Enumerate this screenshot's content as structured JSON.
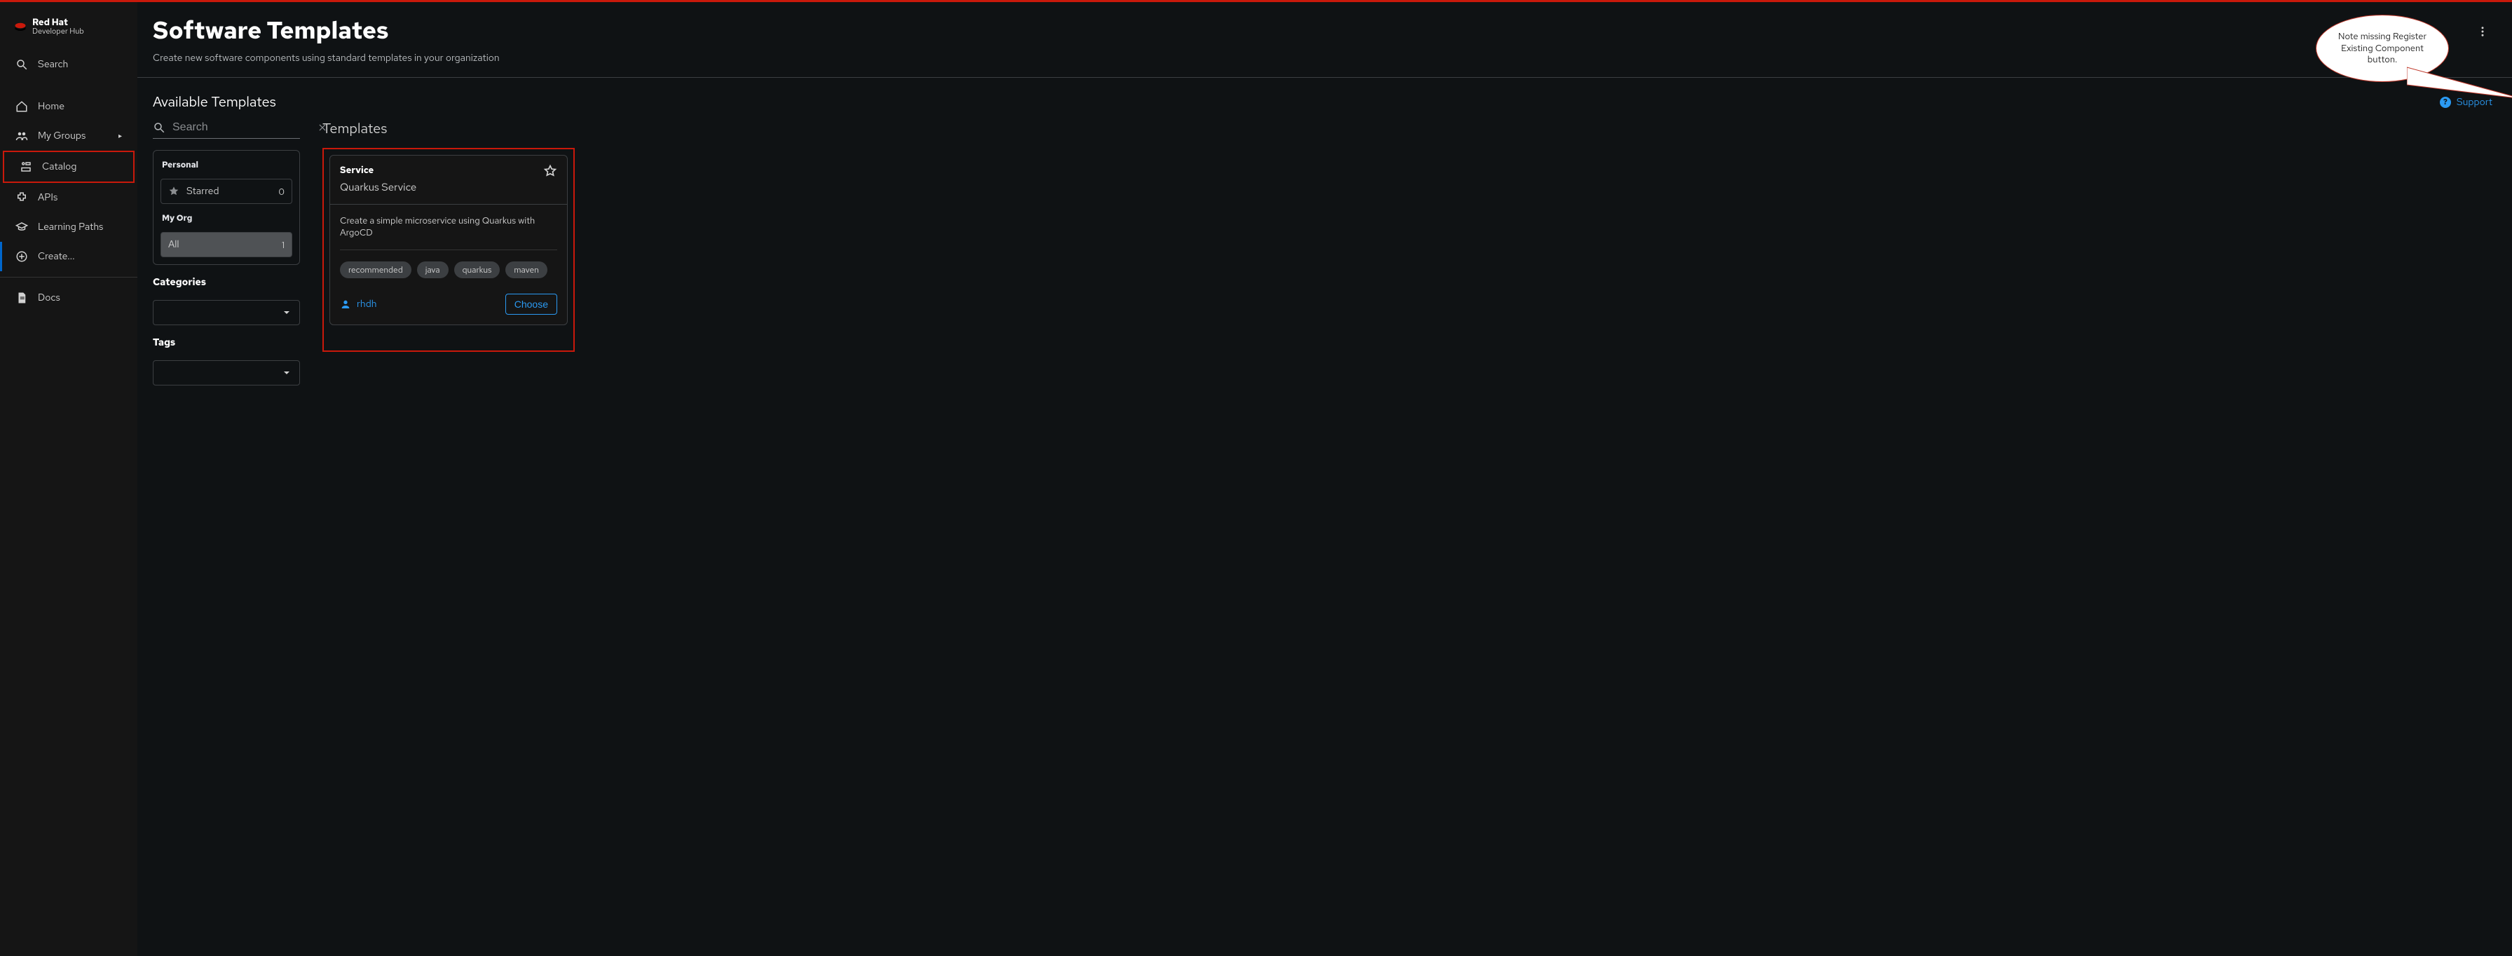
{
  "brand": {
    "name": "Red Hat",
    "sub": "Developer Hub"
  },
  "sidebar": {
    "search": "Search",
    "items": {
      "home": "Home",
      "my_groups": "My Groups",
      "catalog": "Catalog",
      "apis": "APIs",
      "learning_paths": "Learning Paths",
      "create": "Create...",
      "docs": "Docs"
    }
  },
  "header": {
    "title": "Software Templates",
    "subtitle": "Create new software components using standard templates in your organization"
  },
  "section": {
    "available": "Available Templates",
    "support": "Support"
  },
  "filters": {
    "search_placeholder": "Search",
    "personal_heading": "Personal",
    "starred_label": "Starred",
    "starred_count": "0",
    "org_heading": "My Org",
    "all_label": "All",
    "all_count": "1",
    "categories_label": "Categories",
    "tags_label": "Tags"
  },
  "templates": {
    "heading": "Templates",
    "card": {
      "kind": "Service",
      "name": "Quarkus Service",
      "description": "Create a simple microservice using Quarkus with ArgoCD",
      "tags": [
        "recommended",
        "java",
        "quarkus",
        "maven"
      ],
      "owner": "rhdh",
      "choose": "Choose"
    }
  },
  "annotation": "Note missing Register Existing Component button."
}
